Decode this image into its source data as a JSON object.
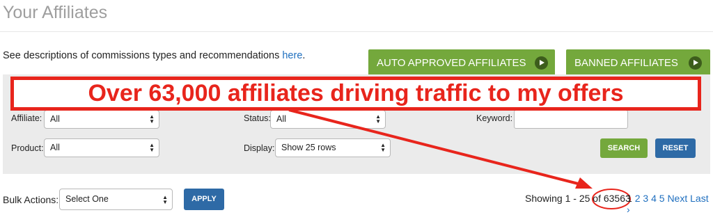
{
  "header": {
    "title": "Your Affiliates"
  },
  "intro": {
    "text": "See descriptions of commissions types and recommendations ",
    "link": "here",
    "suffix": "."
  },
  "top_buttons": {
    "auto_approved": "AUTO APPROVED AFFILIATES",
    "banned": "BANNED AFFILIATES"
  },
  "filters": {
    "affiliate_label": "Affiliate:",
    "affiliate_value": "All",
    "status_label": "Status:",
    "status_value": "All",
    "keyword_label": "Keyword:",
    "keyword_value": "",
    "product_label": "Product:",
    "product_value": "All",
    "display_label": "Display:",
    "display_value": "Show 25 rows",
    "search_label": "SEARCH",
    "reset_label": "RESET"
  },
  "annotation": {
    "text": "Over 63,000 affiliates driving traffic to my offers",
    "color": "#e8251c"
  },
  "bulk": {
    "label": "Bulk Actions:",
    "value": "Select One",
    "apply_label": "APPLY"
  },
  "pagination": {
    "showing_prefix": "Showing 1 - 25 of ",
    "total": "63563",
    "current_page": "1",
    "pages": [
      "2",
      "3",
      "4",
      "5"
    ],
    "next_label": "Next",
    "last_label": "Last ›"
  },
  "colors": {
    "green": "#74a83c",
    "blue": "#2e6aa6",
    "link": "#1f6fbf",
    "annotation_red": "#e8251c"
  }
}
